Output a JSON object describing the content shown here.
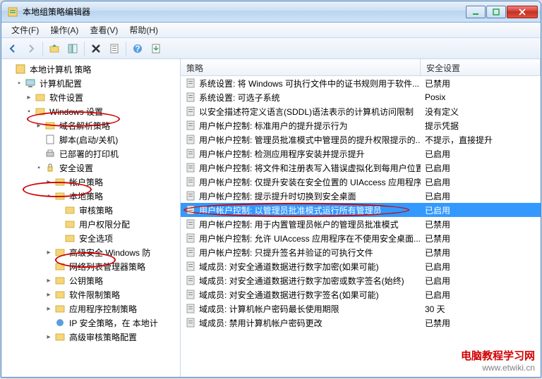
{
  "window": {
    "title": "本地组策略编辑器"
  },
  "menu": {
    "file": "文件(F)",
    "action": "操作(A)",
    "view": "查看(V)",
    "help": "帮助(H)"
  },
  "tree": {
    "root": "本地计算机 策略",
    "computer_config": "计算机配置",
    "software_settings": "软件设置",
    "windows_settings": "Windows 设置",
    "name_resolution": "域名解析策略",
    "scripts": "脚本(启动/关机)",
    "deployed_printers": "已部署的打印机",
    "security_settings": "安全设置",
    "account_policies": "帐户策略",
    "local_policies": "本地策略",
    "audit_policy": "审核策略",
    "user_rights": "用户权限分配",
    "security_options": "安全选项",
    "advanced_windows_fw": "高级安全 Windows 防",
    "network_list": "网络列表管理器策略",
    "public_key": "公钥策略",
    "software_restriction": "软件限制策略",
    "app_control": "应用程序控制策略",
    "ip_security": "IP 安全策略，在 本地计",
    "advanced_audit": "高级审核策略配置"
  },
  "list": {
    "header_policy": "策略",
    "header_setting": "安全设置",
    "rows": [
      {
        "policy": "系统设置: 将 Windows 可执行文件中的证书规则用于软件...",
        "setting": "已禁用"
      },
      {
        "policy": "系统设置: 可选子系统",
        "setting": "Posix"
      },
      {
        "policy": "以安全描述符定义语言(SDDL)语法表示的计算机访问限制",
        "setting": "没有定义"
      },
      {
        "policy": "用户帐户控制: 标准用户的提升提示行为",
        "setting": "提示凭据"
      },
      {
        "policy": "用户帐户控制: 管理员批准模式中管理员的提升权限提示的...",
        "setting": "不提示，直接提升"
      },
      {
        "policy": "用户帐户控制: 检测应用程序安装并提示提升",
        "setting": "已启用"
      },
      {
        "policy": "用户帐户控制: 将文件和注册表写入错误虚拟化到每用户位置",
        "setting": "已启用"
      },
      {
        "policy": "用户帐户控制: 仅提升安装在安全位置的 UIAccess 应用程序",
        "setting": "已启用"
      },
      {
        "policy": "用户帐户控制: 提示提升时切换到安全桌面",
        "setting": "已启用"
      },
      {
        "policy": "用户帐户控制: 以管理员批准模式运行所有管理员",
        "setting": "已启用",
        "selected": true
      },
      {
        "policy": "用户帐户控制: 用于内置管理员帐户的管理员批准模式",
        "setting": "已禁用"
      },
      {
        "policy": "用户帐户控制: 允许 UIAccess 应用程序在不使用安全桌面...",
        "setting": "已禁用"
      },
      {
        "policy": "用户帐户控制: 只提升签名并验证的可执行文件",
        "setting": "已禁用"
      },
      {
        "policy": "域成员: 对安全通道数据进行数字加密(如果可能)",
        "setting": "已启用"
      },
      {
        "policy": "域成员: 对安全通道数据进行数字加密或数字签名(始终)",
        "setting": "已启用"
      },
      {
        "policy": "域成员: 对安全通道数据进行数字签名(如果可能)",
        "setting": "已启用"
      },
      {
        "policy": "域成员: 计算机帐户密码最长使用期限",
        "setting": "30 天"
      },
      {
        "policy": "域成员: 禁用计算机帐户密码更改",
        "setting": "已禁用"
      }
    ]
  },
  "watermark": {
    "line1": "电脑教程学习网",
    "line2": "www.etwiki.cn"
  }
}
